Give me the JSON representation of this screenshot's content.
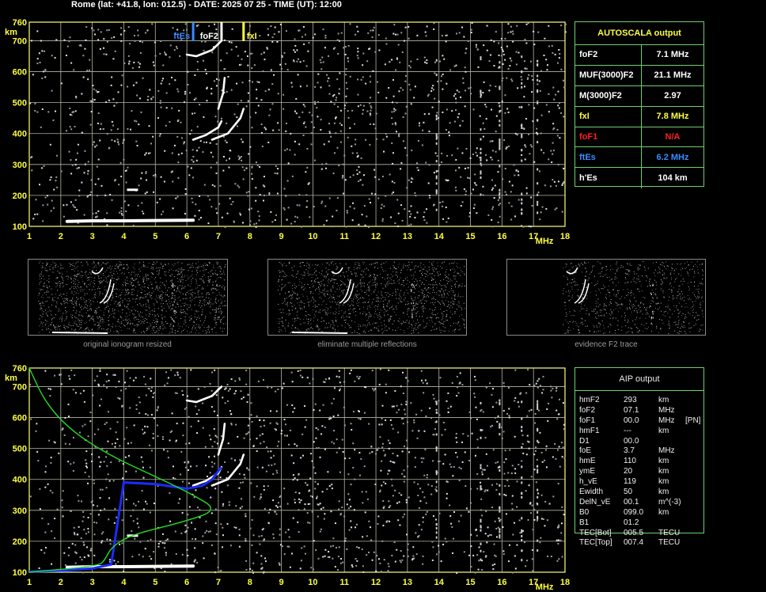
{
  "header": "Rome (lat: +41.8, lon: 012.5) - DATE: 2025 07 25 - TIME (UT): 12:00",
  "colors": {
    "grid": "#b5b5a5",
    "frame": "#ffff80",
    "table_border": "#6fcf6f",
    "yellow": "#ffff40",
    "red": "#ff2020",
    "blue": "#3a8cff",
    "green_profile": "#22dd22",
    "blue_trace": "#1a2cff"
  },
  "ionogram_top": {
    "markers": [
      {
        "label": "ftEs",
        "freq": 6.2,
        "color": "#3a8cff"
      },
      {
        "label": "foF2",
        "freq": 7.1,
        "color": "#ffffff"
      },
      {
        "label": "fxI",
        "freq": 7.8,
        "color": "#ffff40"
      }
    ]
  },
  "chart_data": [
    {
      "type": "scatter",
      "name": "ionogram",
      "x_unit": "MHz",
      "y_unit": "km",
      "xlim": [
        1,
        18
      ],
      "ylim": [
        100,
        760
      ],
      "x_ticks": [
        1,
        2,
        3,
        4,
        5,
        6,
        7,
        8,
        9,
        10,
        11,
        12,
        13,
        14,
        15,
        16,
        17,
        18
      ],
      "y_ticks": [
        100,
        200,
        300,
        400,
        500,
        600,
        700,
        760
      ],
      "grid": true,
      "traces": {
        "es_layer": [
          [
            2.2,
            116
          ],
          [
            3,
            118
          ],
          [
            4,
            118
          ],
          [
            5,
            119
          ],
          [
            6.2,
            120
          ]
        ],
        "f2_o_trace": [
          [
            6.2,
            380
          ],
          [
            6.6,
            395
          ],
          [
            7.0,
            420
          ],
          [
            7.1,
            440
          ]
        ],
        "f2_x_trace": [
          [
            6.8,
            380
          ],
          [
            7.3,
            400
          ],
          [
            7.7,
            450
          ],
          [
            7.8,
            480
          ]
        ],
        "f2_o_vertical": [
          [
            7.0,
            480
          ],
          [
            7.15,
            530
          ],
          [
            7.2,
            580
          ]
        ],
        "second_hop": [
          [
            6.0,
            655
          ],
          [
            6.3,
            650
          ],
          [
            6.8,
            670
          ],
          [
            7.1,
            700
          ]
        ]
      }
    },
    {
      "type": "line",
      "name": "aip_profile",
      "x_unit": "MHz",
      "y_unit": "km",
      "xlim": [
        1,
        18
      ],
      "ylim": [
        100,
        760
      ],
      "x_ticks": [
        1,
        2,
        3,
        4,
        5,
        6,
        7,
        8,
        9,
        10,
        11,
        12,
        13,
        14,
        15,
        16,
        17,
        18
      ],
      "y_ticks": [
        100,
        200,
        300,
        400,
        500,
        600,
        700,
        760
      ],
      "grid": true,
      "electron_density_profile": [
        [
          1.0,
          760
        ],
        [
          1.5,
          650
        ],
        [
          2.3,
          560
        ],
        [
          3.5,
          480
        ],
        [
          5.2,
          400
        ],
        [
          6.2,
          350
        ],
        [
          7.0,
          300
        ],
        [
          5.8,
          260
        ],
        [
          4.2,
          220
        ],
        [
          3.6,
          180
        ],
        [
          3.4,
          140
        ],
        [
          3.2,
          120
        ],
        [
          1.0,
          100
        ]
      ],
      "virtual_height_trace": [
        [
          1.0,
          102
        ],
        [
          2.0,
          105
        ],
        [
          3.0,
          112
        ],
        [
          3.6,
          125
        ],
        [
          4.0,
          390
        ],
        [
          5.0,
          385
        ],
        [
          6.0,
          370
        ],
        [
          6.5,
          380
        ],
        [
          6.8,
          400
        ],
        [
          7.1,
          440
        ]
      ]
    }
  ],
  "autoscala": {
    "title": "AUTOSCALA output",
    "rows": [
      {
        "key": "foF2",
        "value": "7.1 MHz",
        "color": "#ffffff"
      },
      {
        "key": "MUF(3000)F2",
        "value": "21.1 MHz",
        "color": "#ffffff"
      },
      {
        "key": "M(3000)F2",
        "value": "2.97",
        "color": "#ffffff"
      },
      {
        "key": "fxI",
        "value": "7.8 MHz",
        "color": "#ffff40"
      },
      {
        "key": "foF1",
        "value": "N/A",
        "color": "#ff2020"
      },
      {
        "key": "ftEs",
        "value": "6.2 MHz",
        "color": "#3a8cff"
      },
      {
        "key": "h'Es",
        "value": "104    km",
        "color": "#ffffff"
      }
    ]
  },
  "thumbnails": [
    {
      "caption": "original ionogram resized"
    },
    {
      "caption": "eliminate multiple reflections"
    },
    {
      "caption": "evidence F2 trace"
    }
  ],
  "aip": {
    "title": "AIP output",
    "rows": [
      [
        "hmF2",
        "293",
        "km",
        ""
      ],
      [
        "foF2",
        "07.1",
        "MHz",
        ""
      ],
      [
        "foF1",
        "00.0",
        "MHz",
        "[PN]"
      ],
      [
        "hmF1",
        "---",
        "km",
        ""
      ],
      [
        "D1",
        "00.0",
        "",
        ""
      ],
      [
        "foE",
        "3.7",
        "MHz",
        ""
      ],
      [
        "hmE",
        "110",
        "km",
        ""
      ],
      [
        "ymE",
        "20",
        "km",
        ""
      ],
      [
        "h_vE",
        "119",
        "km",
        ""
      ],
      [
        "Ewidth",
        "50",
        "km",
        ""
      ],
      [
        "DelN_vE",
        "00.1",
        "m^(-3)",
        ""
      ],
      [
        "B0",
        "099.0",
        "km",
        ""
      ],
      [
        "B1",
        "01.2",
        "",
        ""
      ],
      [
        "TEC[Bot]",
        "005.5",
        "TECU",
        ""
      ],
      [
        "TEC[Top]",
        "007.4",
        "TECU",
        ""
      ]
    ]
  }
}
